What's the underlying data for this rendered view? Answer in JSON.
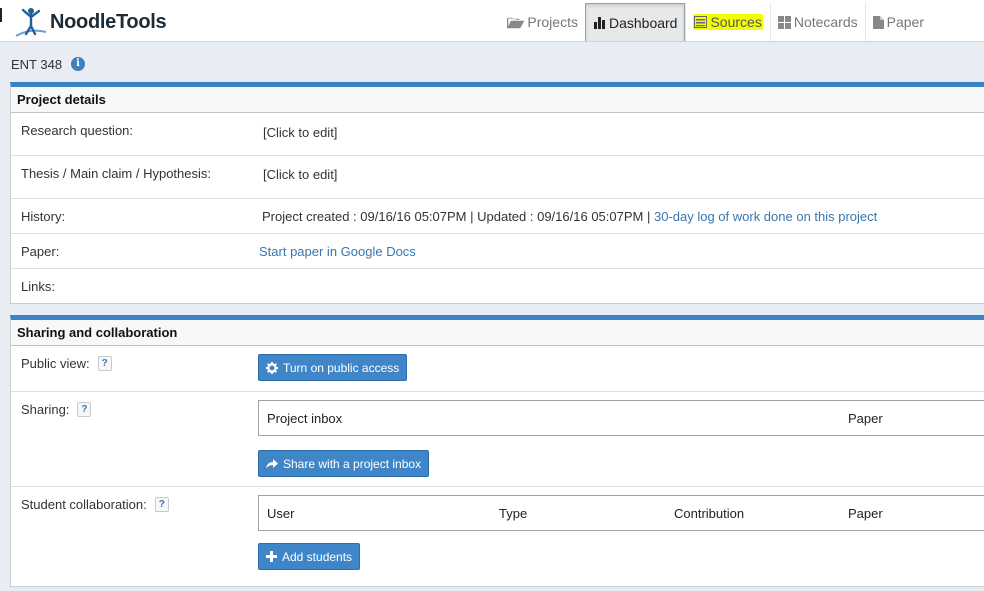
{
  "brand": {
    "name": "NoodleTools"
  },
  "nav": {
    "projects": "Projects",
    "dashboard": "Dashboard",
    "sources": "Sources",
    "notecards": "Notecards",
    "paper": "Paper"
  },
  "project": {
    "title": "ENT 348",
    "info_icon": "info-icon"
  },
  "details": {
    "heading": "Project details",
    "research_label": "Research question:",
    "research_value": "[Click to edit]",
    "thesis_label": "Thesis / Main claim / Hypothesis:",
    "thesis_value": "[Click to edit]",
    "history_label": "History:",
    "history_value": "Project created : 09/16/16 05:07PM | Updated : 09/16/16 05:07PM |",
    "history_link": "30-day log of work done on this project",
    "paper_label": "Paper:",
    "paper_link": "Start paper in Google Docs",
    "links_label": "Links:"
  },
  "sharing": {
    "heading": "Sharing and collaboration",
    "public_label": "Public view:",
    "public_button": "Turn on public access",
    "sharing_label": "Sharing:",
    "inbox_columns": [
      "Project inbox",
      "Paper"
    ],
    "share_button": "Share with a project inbox",
    "collab_label": "Student collaboration:",
    "collab_columns": [
      "User",
      "Type",
      "Contribution",
      "Paper"
    ],
    "add_button": "Add students",
    "help_mark": "?"
  },
  "colors": {
    "accent": "#3b82c4",
    "button": "#3f86c8",
    "link": "#3a76ad",
    "highlight": "#f2ff00",
    "background": "#e7edf2"
  }
}
